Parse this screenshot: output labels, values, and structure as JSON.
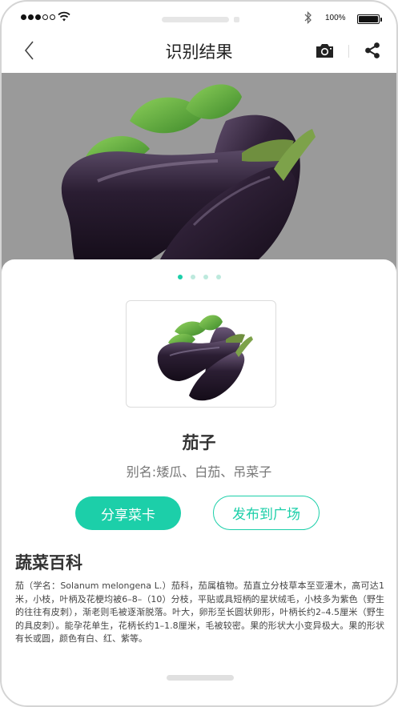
{
  "status_bar": {
    "battery_text": "100%",
    "signal_icon": "cellular-signal-icon",
    "wifi_icon": "wifi-icon",
    "bluetooth_icon": "bluetooth-icon",
    "battery_icon": "battery-icon"
  },
  "nav": {
    "title": "识别结果",
    "back_icon": "chevron-left-icon",
    "camera_icon": "camera-icon",
    "share_icon": "share-icon"
  },
  "carousel": {
    "page_count": 4,
    "active_index": 0
  },
  "result": {
    "name": "茄子",
    "alias": "别名:矮瓜、白茄、吊菜子"
  },
  "actions": {
    "share_card_label": "分享菜卡",
    "post_square_label": "发布到广场"
  },
  "encyclopedia": {
    "title": "蔬菜百科",
    "text": "茄（学名：Solanum melongena L.）茄科，茄属植物。茄直立分枝草本至亚灌木，高可达1米，小枝，叶柄及花梗均被6–8–（10）分枝，平贴或具短柄的星状绒毛，小枝多为紫色（野生的往往有皮刺），渐老则毛被逐渐脱落。叶大，卵形至长圆状卵形，叶柄长约2–4.5厘米（野生的具皮刺）。能孕花单生，花柄长约1–1.8厘米，毛被较密。果的形状大小变异极大。果的形状有长或圆，颜色有白、红、紫等。"
  },
  "colors": {
    "accent": "#1ccfa9",
    "hero_background": "#9a9a9a"
  }
}
